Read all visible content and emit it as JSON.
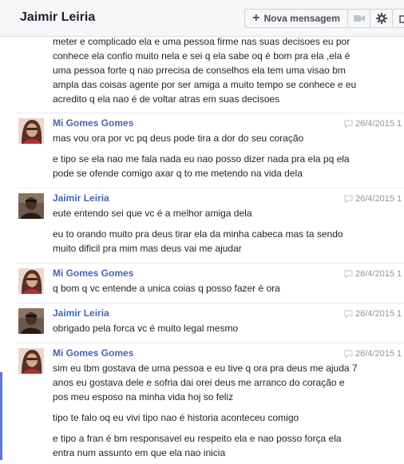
{
  "conversation": {
    "title": "Jaimir Leiria",
    "new_message_label": "Nova mensagem",
    "plus_glyph": "+"
  },
  "messages": [
    {
      "continuation_lines": [
        "meter e complicado ela e uma pessoa firme nas suas decisoes eu por",
        "conhece ela confio muito nela e sei q ela sabe oq é bom pra ela ,ela é",
        "uma pessoa forte q nao prrecisa de conselhos ela tem uma visao bm",
        "ampla das coisas agente por ser amiga a muito tempo se conhece e eu",
        "acredito q ela nao é de voltar atras em suas decisoes"
      ]
    },
    {
      "sender": "Mi Gomes Gomes",
      "time": "26/4/2015 1",
      "avatar": "avatar-mi",
      "paragraphs": [
        [
          "mas vou ora por vc   pq deus pode tira a dor do seu coração"
        ],
        [
          "e tipo se ela nao me fala nada eu nao posso dizer nada pra ela pq ela",
          "pode se ofende comigo axar q to me metendo na vida dela"
        ]
      ]
    },
    {
      "sender": "Jaimir Leiria",
      "time": "26/4/2015 1",
      "avatar": "avatar-jaimir",
      "paragraphs": [
        [
          "eute entendo sei que vc é a melhor amiga dela"
        ],
        [
          "eu to orando muito pra deus tirar ela da minha cabeca mas ta sendo",
          "muito dificil pra mim mas deus vai me ajudar"
        ]
      ]
    },
    {
      "sender": "Mi Gomes Gomes",
      "time": "26/4/2015 1",
      "avatar": "avatar-mi",
      "paragraphs": [
        [
          "q bom q vc entende a unica coias q posso fazer é ora"
        ]
      ]
    },
    {
      "sender": "Jaimir Leiria",
      "time": "26/4/2015 1",
      "avatar": "avatar-jaimir",
      "paragraphs": [
        [
          "obrigado pela forca vc é muito legal mesmo"
        ]
      ]
    },
    {
      "sender": "Mi Gomes Gomes",
      "time": "26/4/2015 1",
      "avatar": "avatar-mi",
      "paragraphs": [
        [
          "sim eu tbm gostava de uma pessoa e eu tive q ora pra deus me ajuda 7",
          "anos eu gostava dele e sofria dai orei deus me arranco do coração e",
          "pos meu esposo na minha vida hoj so feliz"
        ],
        [
          "tipo te falo oq eu vivi tipo nao é historia aconteceu comigo"
        ],
        [
          "e tipo a fran é bm responsavel eu respeito ela e nao posso força ela",
          "entra num assunto em que ela nao inicia"
        ]
      ]
    }
  ]
}
